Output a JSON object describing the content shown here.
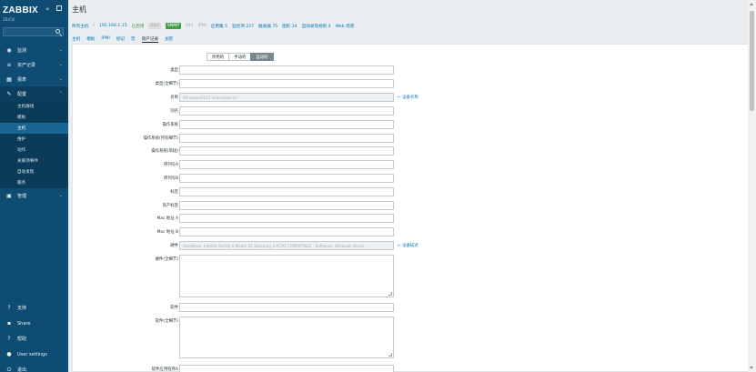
{
  "sidebar": {
    "logo": "ZABBIX",
    "sub": "ZBX56",
    "items": [
      {
        "icon": "◉",
        "label": "监测",
        "icon_name": "eye-icon"
      },
      {
        "icon": "≡",
        "label": "资产记录",
        "icon_name": "list-icon"
      },
      {
        "icon": "▦",
        "label": "报表",
        "icon_name": "chart-icon"
      },
      {
        "icon": "✎",
        "label": "配置",
        "icon_name": "wrench-icon"
      }
    ],
    "submenu": [
      "主机群组",
      "模板",
      "主机",
      "维护",
      "动作",
      "关联项事件",
      "自动发现",
      "服务"
    ],
    "admin": {
      "icon": "▣",
      "label": "管理"
    },
    "bottom": [
      {
        "icon": "?",
        "label": "支持",
        "icon_name": "support-icon"
      },
      {
        "icon": "▪",
        "label": "Share",
        "icon_name": "share-icon"
      },
      {
        "icon": "?",
        "label": "帮助",
        "icon_name": "help-icon"
      },
      {
        "icon": "●",
        "label": "User settings",
        "icon_name": "user-icon"
      },
      {
        "icon": "⏻",
        "label": "退出",
        "icon_name": "logout-icon"
      }
    ]
  },
  "header": {
    "title": "主机"
  },
  "breadcrumb": {
    "all_hosts": "所有主机",
    "sep": "/",
    "host": "192.168.1.15",
    "enabled": "已启用",
    "zbx": "ZBX",
    "snmp": "SNMP",
    "jmx": "JMX",
    "ipmi": "IPMI",
    "apps": "应用集 5",
    "items": "监控项 227",
    "triggers": "触发器 75",
    "graphs": "图形 24",
    "discovery": "自动发现规则 4",
    "web": "Web 场景"
  },
  "tabs": [
    "主机",
    "模板",
    "IPMI",
    "标记",
    "宏",
    "资产记录",
    "加密"
  ],
  "inventory_mode": [
    "停用的",
    "手动的",
    "自动的"
  ],
  "form": {
    "type": "类型",
    "type_full": "类型(全细节)",
    "name": "名称",
    "name_value": "WindowsIS012-H.bu.baan.cn",
    "alias": "别名",
    "os": "操作系统",
    "os_full": "操作系统(所有细节)",
    "os_short": "操作系统(简短)",
    "serial_a": "序列号A",
    "serial_b": "序列号B",
    "tag": "标签",
    "asset_tag": "资产标签",
    "mac_a": "Mac 地址 A",
    "mac_b": "Mac 地址 B",
    "hardware": "硬件",
    "hardware_value": "Hardware: Intel64 Family 6 Model 62 Stepping 4 AT/AT COMPATIBLE - Software: Windows Versio",
    "hardware_full": "硬件(全细节)",
    "software": "软件",
    "software_full": "软件(全细节)",
    "software_app_a": "软件应用程序A",
    "link_name": "← 设备名称",
    "link_hardware": "← 设备描述"
  }
}
